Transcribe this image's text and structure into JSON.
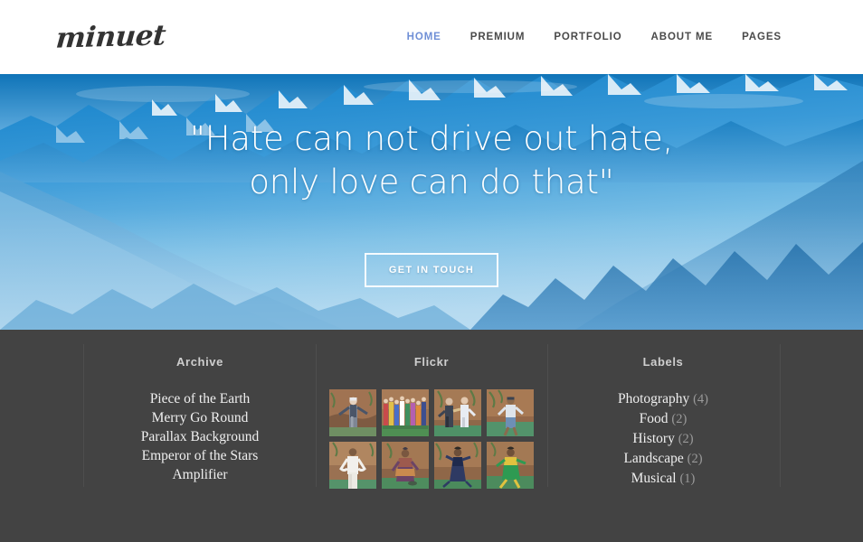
{
  "header": {
    "logo_text": "minuet",
    "nav": [
      {
        "label": "HOME",
        "active": true
      },
      {
        "label": "PREMIUM",
        "active": false
      },
      {
        "label": "PORTFOLIO",
        "active": false
      },
      {
        "label": "ABOUT ME",
        "active": false
      },
      {
        "label": "PAGES",
        "active": false
      }
    ]
  },
  "hero": {
    "quote_line1": "\"Hate can not drive out hate,",
    "quote_line2": "only love can do that\"",
    "cta_label": "GET IN TOUCH",
    "background_image": "snow-capped-blue-mountain-range-haze"
  },
  "footer": {
    "archive": {
      "title": "Archive",
      "items": [
        "Piece of the Earth",
        "Merry Go Round",
        "Parallax Background",
        "Emperor of the Stars",
        "Amplifier"
      ]
    },
    "flickr": {
      "title": "Flickr",
      "thumbs": [
        {
          "alt": "man-in-suit-arms-out"
        },
        {
          "alt": "group-of-costumed-people"
        },
        {
          "alt": "two-people-dancing"
        },
        {
          "alt": "man-in-white-tshirt-walking"
        },
        {
          "alt": "man-in-white-outfit-standing"
        },
        {
          "alt": "performer-in-purple-costume"
        },
        {
          "alt": "dancer-in-blue-dress"
        },
        {
          "alt": "dancer-in-green-yellow-outfit"
        }
      ]
    },
    "labels": {
      "title": "Labels",
      "items": [
        {
          "name": "Photography",
          "count": "(4)"
        },
        {
          "name": "Food",
          "count": "(2)"
        },
        {
          "name": "History",
          "count": "(2)"
        },
        {
          "name": "Landscape",
          "count": "(2)"
        },
        {
          "name": "Musical",
          "count": "(1)"
        }
      ]
    }
  },
  "colors": {
    "header_bg": "#ffffff",
    "nav_active": "#6f8fd6",
    "nav_default": "#4a4a4a",
    "footer_bg": "#434343",
    "footer_divider": "#4e4e4e",
    "footer_title": "#cfcfcf",
    "footer_text": "#efefef",
    "label_count": "#9a9a9a",
    "hero_text": "#ffffff"
  }
}
